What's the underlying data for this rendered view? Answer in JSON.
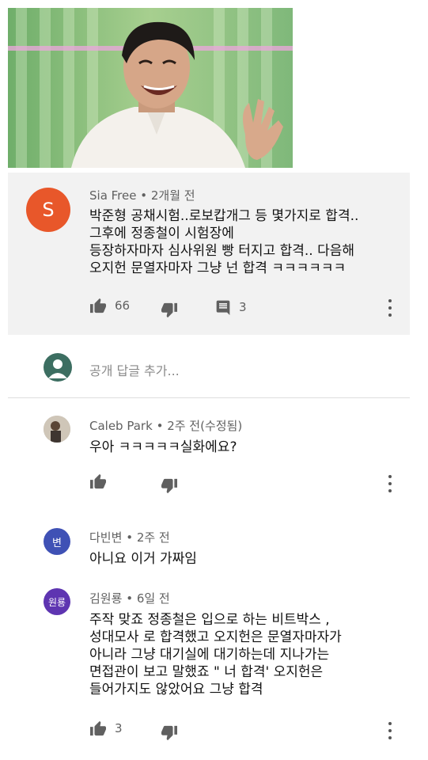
{
  "main_comment": {
    "avatar_letter": "S",
    "avatar_color": "#e8572a",
    "author": "Sia Free",
    "time": "2개월 전",
    "text": "박준형 공채시험..로보캅개그 등 몇가지로 합격..\n그후에 정종철이 시험장에\n등장하자마자 심사위원 빵 터지고 합격.. 다음해\n오지헌 문열자마자 그냥 넌 합격 ㅋㅋㅋㅋㅋㅋ",
    "likes": "66",
    "replies": "3"
  },
  "reply_input": {
    "placeholder": "공개 답글 추가..."
  },
  "replies": [
    {
      "author": "Caleb Park",
      "time": "2주 전(수정됨)",
      "text": "우아 ㅋㅋㅋㅋㅋ실화에요?",
      "likes": ""
    },
    {
      "avatar_label": "변",
      "avatar_color": "#3f51b5",
      "author": "다빈변",
      "time": "2주 전",
      "text": "아니요 이거 가짜임",
      "likes": ""
    },
    {
      "avatar_label": "원룡",
      "avatar_color": "#5e35b1",
      "author": "김원룡",
      "time": "6일 전",
      "text": "주작 맞죠 정종철은 입으로 하는 비트박스 ,\n성대모사 로 합격했고 오지헌은 문열자마자가\n아니라 그냥 대기실에 대기하는데 지나가는\n면접관이 보고 말했죠  \" 너 합격' 오지헌은\n들어가지도 않았어요 그냥 합격",
      "likes": "3"
    }
  ],
  "icons": {
    "like": "thumbs-up-icon",
    "dislike": "thumbs-down-icon",
    "reply": "comment-icon",
    "more": "more-vertical-icon",
    "user": "account-icon"
  }
}
